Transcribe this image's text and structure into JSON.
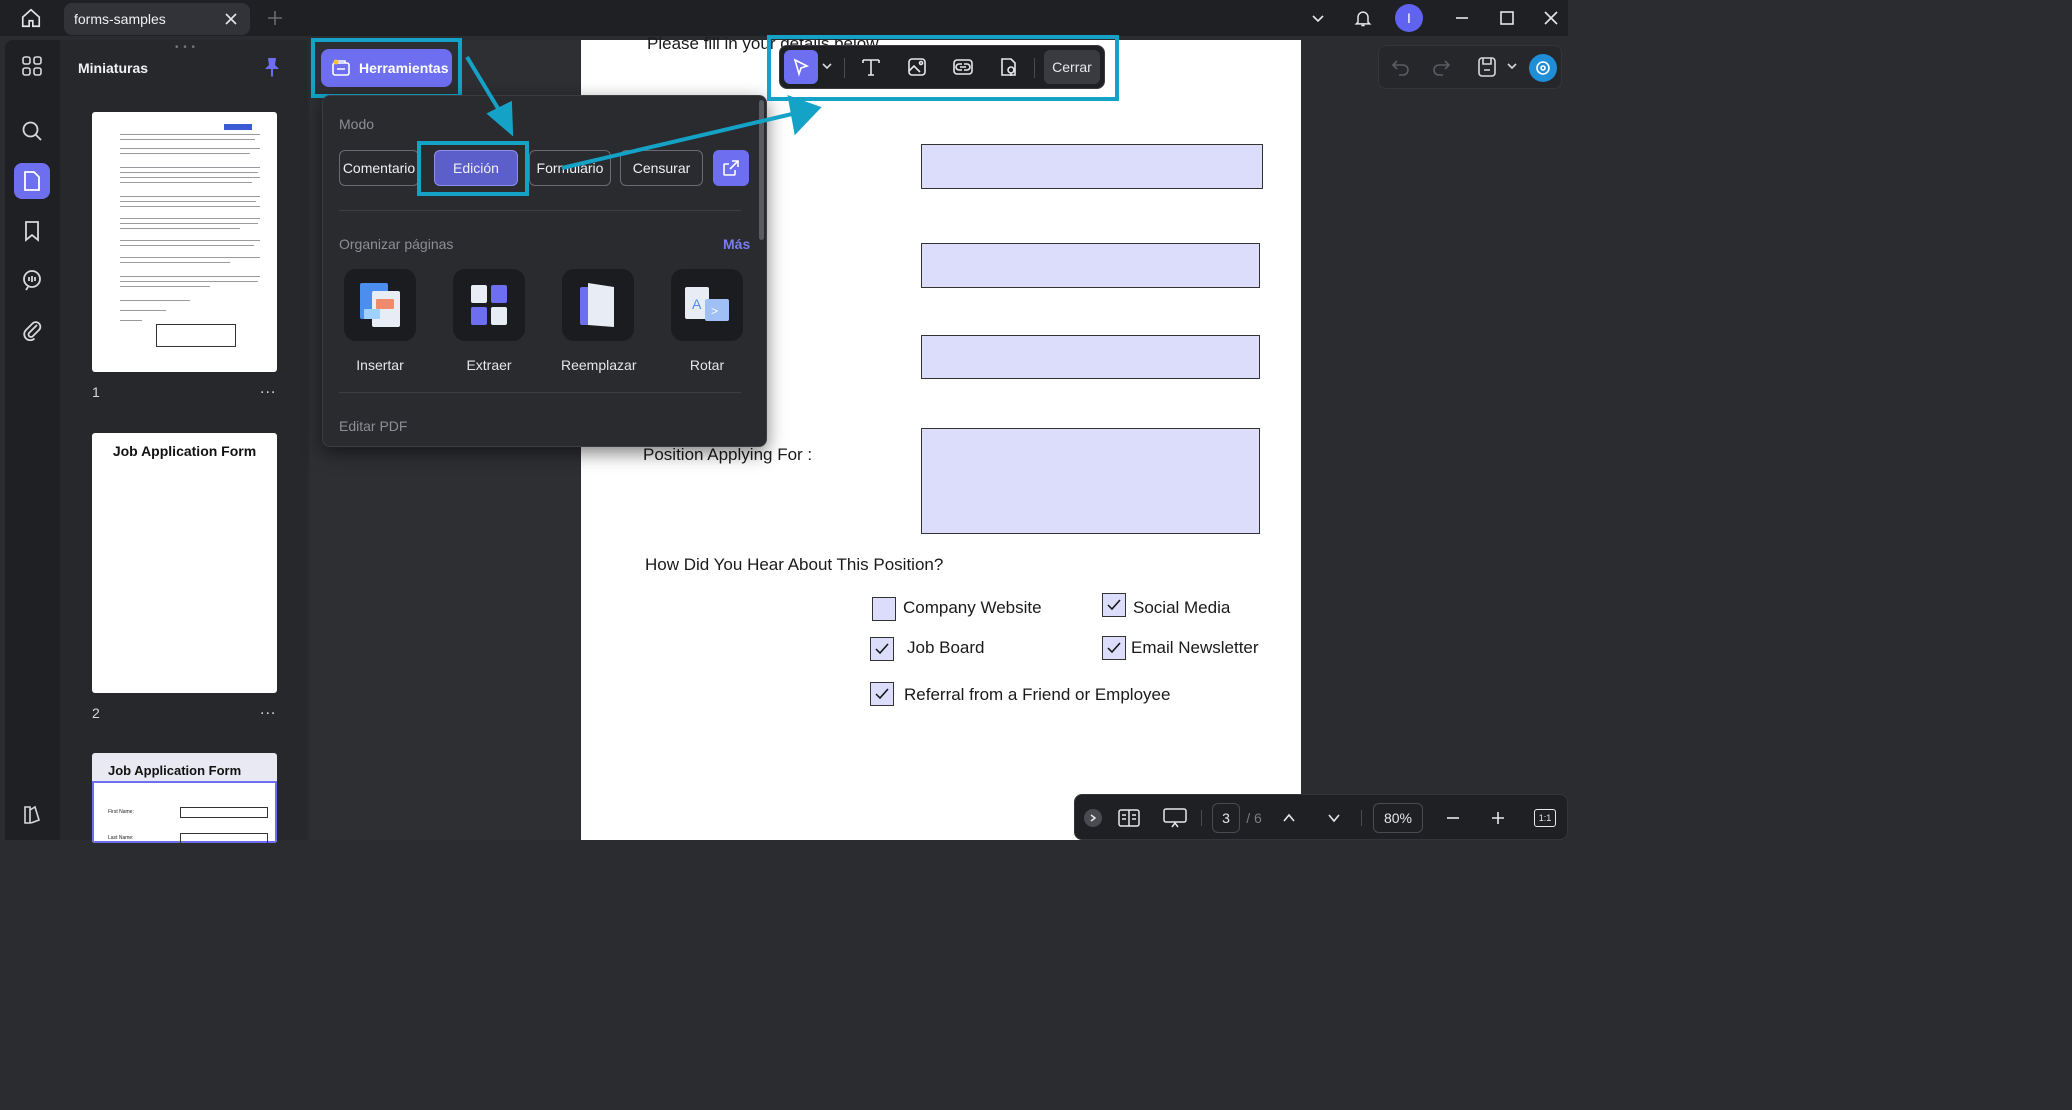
{
  "titlebar": {
    "tab_title": "forms-samples",
    "user_initial": "I"
  },
  "thumbnails": {
    "title": "Miniaturas",
    "pages": [
      {
        "number": "1",
        "more": "...",
        "heading": ""
      },
      {
        "number": "2",
        "more": "...",
        "heading": "Job Application Form"
      },
      {
        "number": "3",
        "more": "",
        "heading": "Job Application Form",
        "labels": [
          "First Name:",
          "Last Name:"
        ]
      }
    ]
  },
  "tools_button": {
    "label": "Herramientas"
  },
  "tools_panel": {
    "mode_label": "Modo",
    "modes": [
      "Comentario",
      "Edición",
      "Formulario",
      "Censurar"
    ],
    "active_mode": "Edición",
    "organize_label": "Organizar páginas",
    "more_label": "Más",
    "organize_items": [
      "Insertar",
      "Extraer",
      "Reemplazar",
      "Rotar"
    ],
    "edit_pdf_label": "Editar PDF"
  },
  "edit_toolbar": {
    "close_label": "Cerrar"
  },
  "document": {
    "intro_text": "Please fill in your details below",
    "position_label": "Position Applying For :",
    "hear_question": "How Did You Hear About This Position?",
    "options": [
      {
        "label": "Company Website",
        "checked": false
      },
      {
        "label": "Social Media",
        "checked": true
      },
      {
        "label": "Job Board",
        "checked": true
      },
      {
        "label": "Email Newsletter",
        "checked": true
      },
      {
        "label": "Referral from a Friend or Employee",
        "checked": true
      }
    ]
  },
  "bottom_nav": {
    "current_page": "3",
    "total_pages": "/ 6",
    "zoom": "80%",
    "fit_label": "1:1"
  },
  "colors": {
    "accent": "#6d6ff0",
    "highlight_outline": "#14a3c7",
    "field_fill": "#dcdcfb"
  }
}
